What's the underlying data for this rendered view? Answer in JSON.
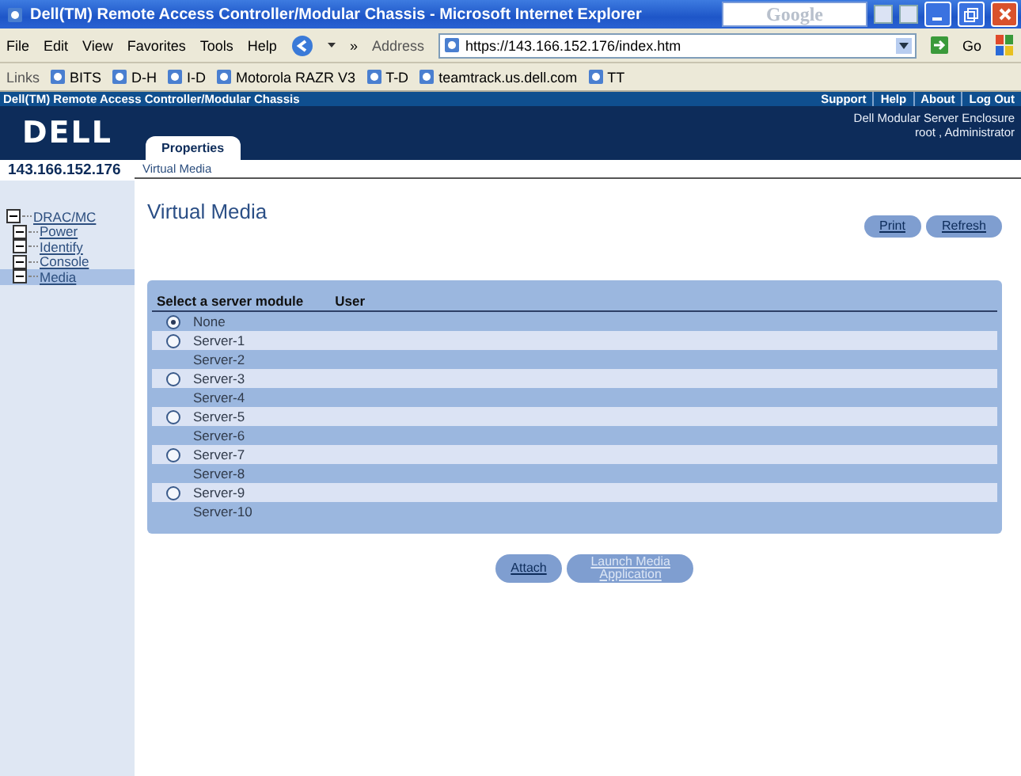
{
  "window": {
    "title": "Dell(TM) Remote Access Controller/Modular Chassis - Microsoft Internet Explorer",
    "search_placeholder": "Google"
  },
  "menu": [
    "File",
    "Edit",
    "View",
    "Favorites",
    "Tools",
    "Help"
  ],
  "toolbar_chevron": "»",
  "address": {
    "label": "Address",
    "value": "https://143.166.152.176/index.htm",
    "go": "Go"
  },
  "links": {
    "label": "Links",
    "items": [
      "BITS",
      "D-H",
      "I-D",
      "Motorola RAZR V3",
      "T-D",
      "teamtrack.us.dell.com",
      "TT"
    ]
  },
  "header": {
    "title": "Dell(TM) Remote Access Controller/Modular Chassis",
    "logo": "DELL",
    "top_links": [
      "Support",
      "Help",
      "About",
      "Log Out"
    ],
    "enclosure": "Dell Modular Server Enclosure",
    "user": "root , Administrator"
  },
  "tabs": [
    {
      "label": "Properties",
      "selected": true
    }
  ],
  "breadcrumb": "Virtual Media",
  "sidebar": {
    "host": "143.166.152.176",
    "tree": [
      {
        "label": "DRAC/MC",
        "selected": false,
        "children": [
          {
            "label": "Power",
            "selected": false
          },
          {
            "label": "Identify",
            "selected": false
          },
          {
            "label": "Console",
            "selected": false
          },
          {
            "label": "Media",
            "selected": true
          }
        ]
      }
    ]
  },
  "page": {
    "title": "Virtual Media",
    "actions": [
      "Print",
      "Refresh"
    ],
    "table": {
      "columns": [
        "Select a server module",
        "User"
      ],
      "rows": [
        {
          "name": "None",
          "selectable": true,
          "selected": true
        },
        {
          "name": "Server-1",
          "selectable": true,
          "selected": false
        },
        {
          "name": "Server-2",
          "selectable": false,
          "selected": false
        },
        {
          "name": "Server-3",
          "selectable": true,
          "selected": false
        },
        {
          "name": "Server-4",
          "selectable": false,
          "selected": false
        },
        {
          "name": "Server-5",
          "selectable": true,
          "selected": false
        },
        {
          "name": "Server-6",
          "selectable": false,
          "selected": false
        },
        {
          "name": "Server-7",
          "selectable": true,
          "selected": false
        },
        {
          "name": "Server-8",
          "selectable": false,
          "selected": false
        },
        {
          "name": "Server-9",
          "selectable": true,
          "selected": false
        },
        {
          "name": "Server-10",
          "selectable": false,
          "selected": false
        }
      ]
    },
    "buttons": [
      {
        "label": "Attach",
        "disabled": false
      },
      {
        "label": "Launch Media Application",
        "disabled": true
      }
    ]
  }
}
